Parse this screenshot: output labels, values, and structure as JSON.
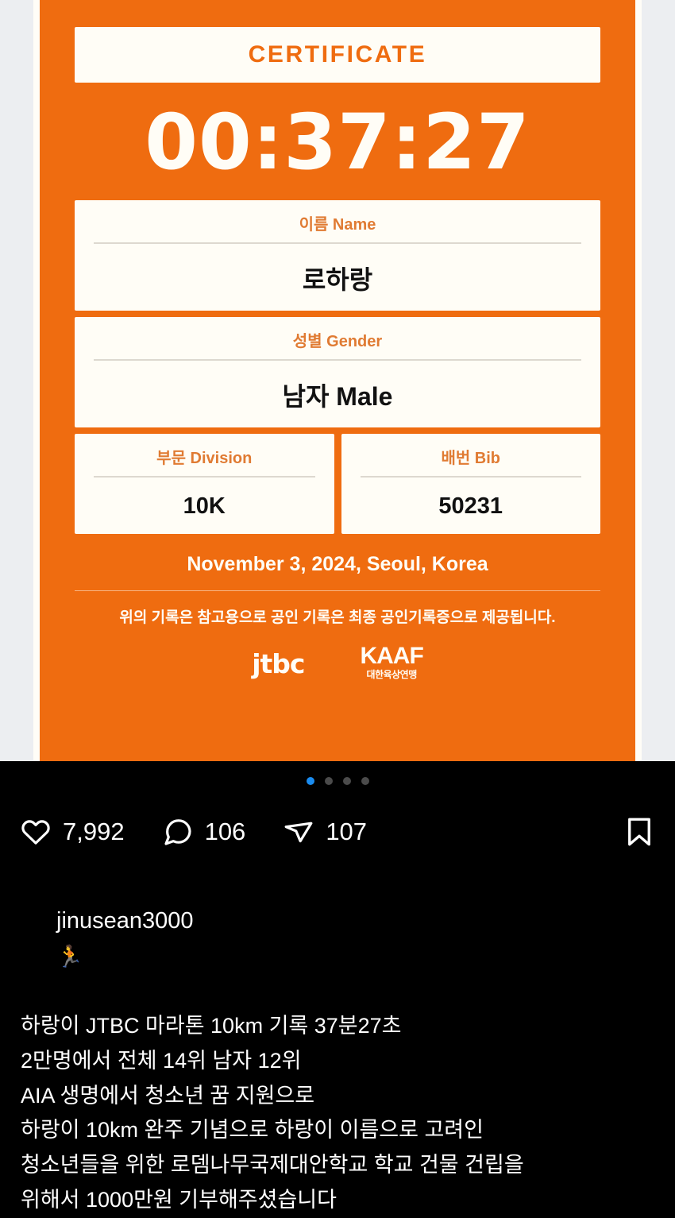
{
  "post": {
    "username": "jinusean3000",
    "username_emoji": "🏃",
    "caption_lines": [
      "하랑이 JTBC 마라톤 10km 기록 37분27초",
      "2만명에서 전체 14위 남자 12위",
      "AIA 생명에서 청소년 꿈 지원으로",
      "하랑이 10km 완주 기념으로 하랑이 이름으로 고려인",
      "청소년들을 위한 로뎀나무국제대안학교 학교 건물 건립을",
      "위해서 1000만원 기부해주셨습니다"
    ]
  },
  "actions": {
    "like_count": "7,992",
    "comment_count": "106",
    "share_count": "107"
  },
  "carousel": {
    "total": 4,
    "active_index": 0,
    "active_color": "#1a8cf0",
    "inactive_color": "#4b4b4b"
  },
  "certificate": {
    "title": "CERTIFICATE",
    "finish_time": "00:37:27",
    "accent_color": "#ef6c10",
    "card_color": "#fffdf6",
    "label_color": "#e07b33",
    "fields": [
      {
        "label": "이름 Name",
        "value": "로하랑"
      },
      {
        "label": "성별 Gender",
        "value": "남자 Male"
      }
    ],
    "fields_row": [
      {
        "label": "부문 Division",
        "value": "10K"
      },
      {
        "label": "배번 Bib",
        "value": "50231"
      }
    ],
    "date_location": "November 3, 2024, Seoul, Korea",
    "note": "위의 기록은 참고용으로 공인 기록은 최종 공인기록증으로 제공됩니다.",
    "logos": {
      "broadcaster": "jtbc",
      "federation_abbr": "KAAF",
      "federation_kr": "대한육상연맹"
    }
  }
}
